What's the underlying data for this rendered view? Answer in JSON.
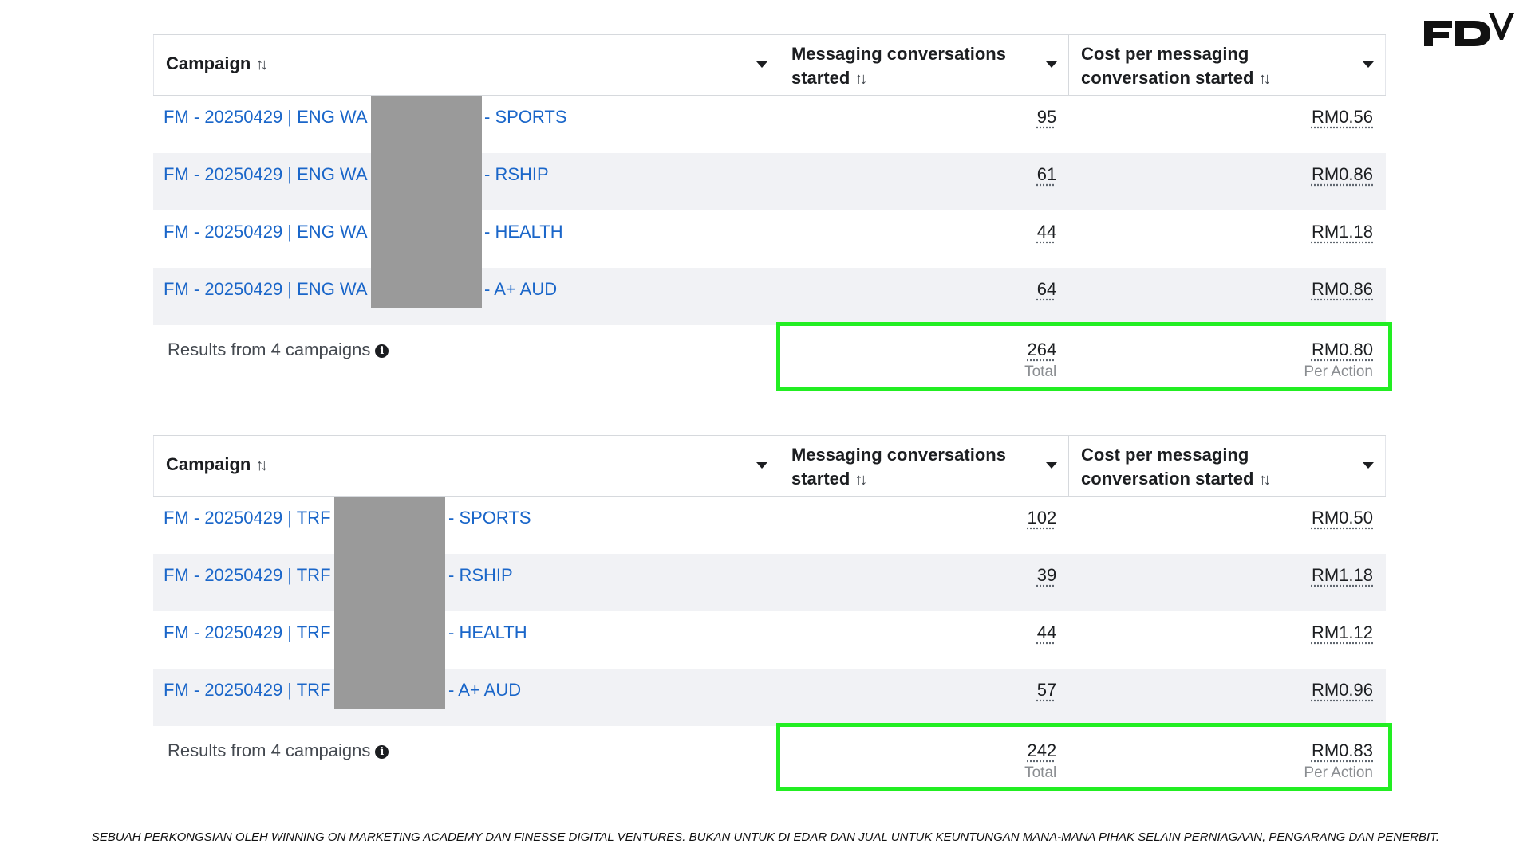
{
  "brand": {
    "logo_text": "FDV"
  },
  "tables": [
    {
      "headers": {
        "campaign": "Campaign",
        "messaging_line1": "Messaging conversations",
        "messaging_line2": "started",
        "cost_line1": "Cost per messaging",
        "cost_line2": "conversation started"
      },
      "rows": [
        {
          "prefix": "FM - 20250429 | ENG WA |",
          "suffix": "- SPORTS",
          "conversations": "95",
          "cost": "RM0.56"
        },
        {
          "prefix": "FM - 20250429 | ENG WA |",
          "suffix": "- RSHIP",
          "conversations": "61",
          "cost": "RM0.86"
        },
        {
          "prefix": "FM - 20250429 | ENG WA |",
          "suffix": "- HEALTH",
          "conversations": "44",
          "cost": "RM1.18"
        },
        {
          "prefix": "FM - 20250429 | ENG WA |",
          "suffix": "- A+ AUD",
          "conversations": "64",
          "cost": "RM0.86"
        }
      ],
      "summary": {
        "label": "Results from 4 campaigns",
        "total": "264",
        "total_label": "Total",
        "per_action": "RM0.80",
        "per_action_label": "Per Action"
      }
    },
    {
      "headers": {
        "campaign": "Campaign",
        "messaging_line1": "Messaging conversations",
        "messaging_line2": "started",
        "cost_line1": "Cost per messaging",
        "cost_line2": "conversation started"
      },
      "rows": [
        {
          "prefix": "FM - 20250429 | TRF |",
          "suffix": "- SPORTS",
          "conversations": "102",
          "cost": "RM0.50"
        },
        {
          "prefix": "FM - 20250429 | TRF |",
          "suffix": "- RSHIP",
          "conversations": "39",
          "cost": "RM1.18"
        },
        {
          "prefix": "FM - 20250429 | TRF |",
          "suffix": "- HEALTH",
          "conversations": "44",
          "cost": "RM1.12"
        },
        {
          "prefix": "FM - 20250429 | TRF |",
          "suffix": "- A+ AUD",
          "conversations": "57",
          "cost": "RM0.96"
        }
      ],
      "summary": {
        "label": "Results from 4 campaigns",
        "total": "242",
        "total_label": "Total",
        "per_action": "RM0.83",
        "per_action_label": "Per Action"
      }
    }
  ],
  "highlight_color": "#22ee22",
  "footer": "SEBUAH PERKONGSIAN OLEH WINNING ON MARKETING ACADEMY  DAN FINESSE DIGITAL VENTURES. BUKAN UNTUK DI EDAR DAN JUAL UNTUK KEUNTUNGAN MANA-MANA PIHAK SELAIN PERNIAGAAN, PENGARANG DAN PENERBIT."
}
